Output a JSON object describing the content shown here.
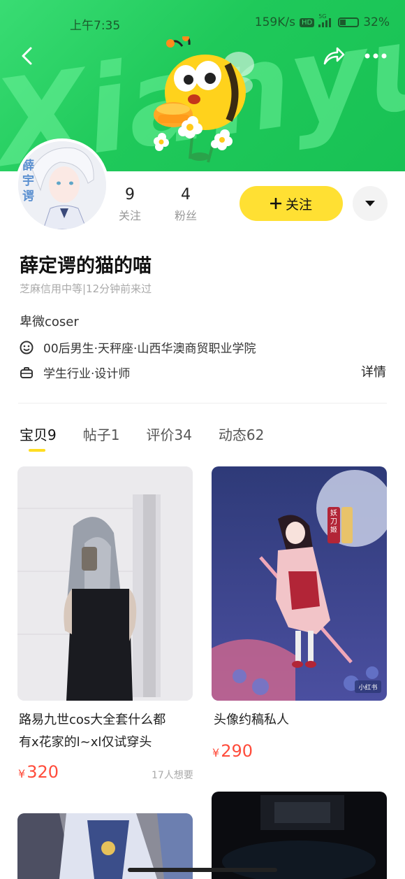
{
  "status_bar": {
    "time": "上午7:35",
    "network_speed": "159K/s",
    "hd_badge": "HD",
    "network_type": "5G",
    "battery": "32%"
  },
  "header": {
    "watermark_text": "Xianyu"
  },
  "profile": {
    "avatar_text": "薛宇谔",
    "following_count": "9",
    "following_label": "关注",
    "followers_count": "4",
    "followers_label": "粉丝",
    "follow_button_label": "关注",
    "username": "薛定谔的猫的喵",
    "meta_line": "芝麻信用中等|12分钟前来过",
    "bio": "卑微coser",
    "info_1": "00后男生·天秤座·山西华澳商贸职业学院",
    "info_2": "学生行业·设计师",
    "detail_link": "详情"
  },
  "tabs": [
    {
      "label": "宝贝9",
      "active": true
    },
    {
      "label": "帖子1",
      "active": false
    },
    {
      "label": "评价34",
      "active": false
    },
    {
      "label": "动态62",
      "active": false
    }
  ],
  "items": [
    {
      "title_line1": "路易九世cos大全套什么都",
      "title_line2": "有x花家的l~xl仅试穿头",
      "price_symbol": "¥",
      "price": "320",
      "wants": "17人想要"
    },
    {
      "title_line1": "头像约稿私人",
      "price_symbol": "¥",
      "price": "290",
      "card_tag_1": "妖刀姬",
      "card_tag_2": "小红书"
    }
  ],
  "colors": {
    "header_green": "#1fc95a",
    "follow_yellow": "#ffe033",
    "price_red": "#ff4c3b"
  }
}
